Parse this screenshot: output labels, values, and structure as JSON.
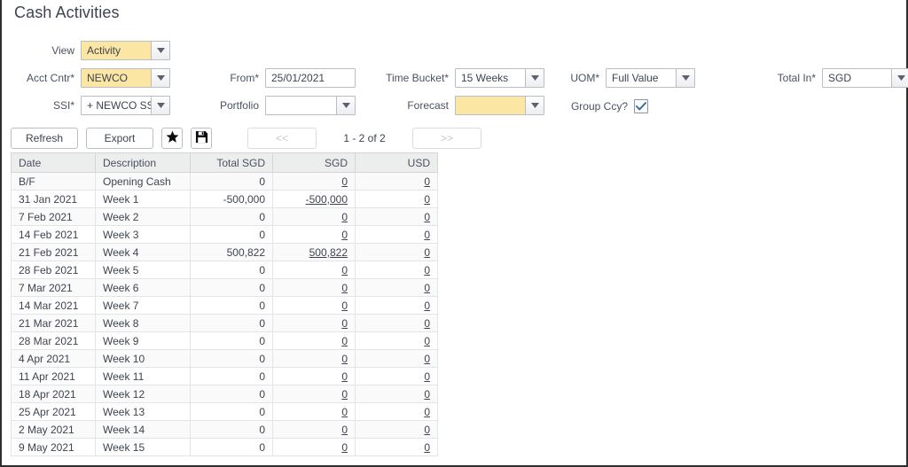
{
  "page": {
    "title": "Cash Activities"
  },
  "form": {
    "view": {
      "label": "View",
      "value": "Activity",
      "style": "yellow"
    },
    "acct_cntr": {
      "label": "Acct Cntr*",
      "value": "NEWCO",
      "style": "yellow"
    },
    "ssi": {
      "label": "SSI*",
      "value": "+ NEWCO SSI",
      "style": "plain"
    },
    "from": {
      "label": "From*",
      "value": "25/01/2021"
    },
    "portfolio": {
      "label": "Portfolio",
      "value": "",
      "style": "plain"
    },
    "time_bucket": {
      "label": "Time Bucket*",
      "value": "15 Weeks",
      "style": "plain"
    },
    "forecast": {
      "label": "Forecast",
      "value": "",
      "style": "yellow"
    },
    "uom": {
      "label": "UOM*",
      "value": "Full Value",
      "style": "plain"
    },
    "group_ccy": {
      "label": "Group Ccy?",
      "checked": true
    },
    "total_in": {
      "label": "Total In*",
      "value": "SGD",
      "style": "plain"
    }
  },
  "toolbar": {
    "refresh_label": "Refresh",
    "export_label": "Export",
    "favorite_icon": "star-icon",
    "save_icon": "floppy-disk-icon",
    "prev_label": "<<",
    "next_label": ">>",
    "page_count": "1 - 2 of 2"
  },
  "table": {
    "columns": [
      "Date",
      "Description",
      "Total SGD",
      "SGD",
      "USD"
    ],
    "rows": [
      {
        "date": "B/F",
        "desc": "Opening Cash",
        "total": "0",
        "sgd": "0",
        "usd": "0",
        "neg": false
      },
      {
        "date": "31 Jan 2021",
        "desc": "Week 1",
        "total": "-500,000",
        "sgd": "-500,000",
        "usd": "0",
        "neg": true
      },
      {
        "date": "7 Feb 2021",
        "desc": "Week 2",
        "total": "0",
        "sgd": "0",
        "usd": "0",
        "neg": false
      },
      {
        "date": "14 Feb 2021",
        "desc": "Week 3",
        "total": "0",
        "sgd": "0",
        "usd": "0",
        "neg": false
      },
      {
        "date": "21 Feb 2021",
        "desc": "Week 4",
        "total": "500,822",
        "sgd": "500,822",
        "usd": "0",
        "neg": false
      },
      {
        "date": "28 Feb 2021",
        "desc": "Week 5",
        "total": "0",
        "sgd": "0",
        "usd": "0",
        "neg": false
      },
      {
        "date": "7 Mar 2021",
        "desc": "Week 6",
        "total": "0",
        "sgd": "0",
        "usd": "0",
        "neg": false
      },
      {
        "date": "14 Mar 2021",
        "desc": "Week 7",
        "total": "0",
        "sgd": "0",
        "usd": "0",
        "neg": false
      },
      {
        "date": "21 Mar 2021",
        "desc": "Week 8",
        "total": "0",
        "sgd": "0",
        "usd": "0",
        "neg": false
      },
      {
        "date": "28 Mar 2021",
        "desc": "Week 9",
        "total": "0",
        "sgd": "0",
        "usd": "0",
        "neg": false
      },
      {
        "date": "4 Apr 2021",
        "desc": "Week 10",
        "total": "0",
        "sgd": "0",
        "usd": "0",
        "neg": false
      },
      {
        "date": "11 Apr 2021",
        "desc": "Week 11",
        "total": "0",
        "sgd": "0",
        "usd": "0",
        "neg": false
      },
      {
        "date": "18 Apr 2021",
        "desc": "Week 12",
        "total": "0",
        "sgd": "0",
        "usd": "0",
        "neg": false
      },
      {
        "date": "25 Apr 2021",
        "desc": "Week 13",
        "total": "0",
        "sgd": "0",
        "usd": "0",
        "neg": false
      },
      {
        "date": "2 May 2021",
        "desc": "Week 14",
        "total": "0",
        "sgd": "0",
        "usd": "0",
        "neg": false
      },
      {
        "date": "9 May 2021",
        "desc": "Week 15",
        "total": "0",
        "sgd": "0",
        "usd": "0",
        "neg": false
      }
    ]
  },
  "colors": {
    "positive": "#2323c8",
    "negative": "#e81414",
    "highlight_field": "#fce6a4",
    "header_bg": "#eceded"
  }
}
